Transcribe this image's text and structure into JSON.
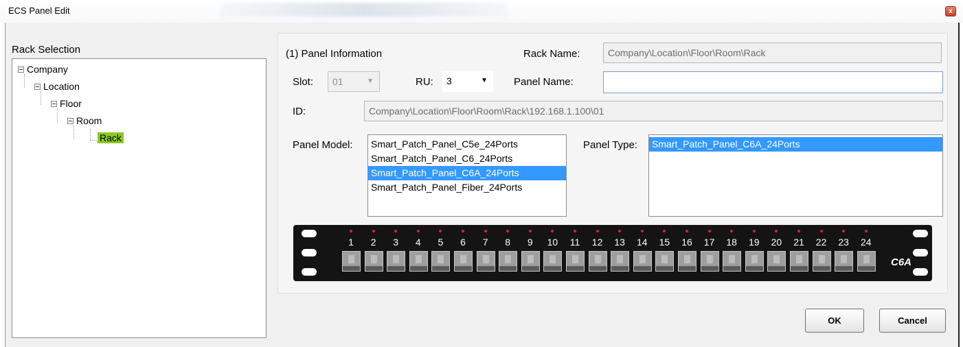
{
  "window": {
    "title": "ECS Panel Edit",
    "close_glyph": "x"
  },
  "rack_selection": {
    "label": "Rack Selection",
    "tree": {
      "company": "Company",
      "location": "Location",
      "floor": "Floor",
      "room": "Room",
      "rack": "Rack"
    },
    "selected_color": "#8ac927"
  },
  "panel_info": {
    "section_title": "(1) Panel Information",
    "rack_name_label": "Rack Name:",
    "rack_name_value": "Company\\Location\\Floor\\Room\\Rack",
    "slot_label": "Slot:",
    "slot_value": "01",
    "ru_label": "RU:",
    "ru_value": "3",
    "panel_name_label": "Panel Name:",
    "panel_name_value": "",
    "id_label": "ID:",
    "id_value": "Company\\Location\\Floor\\Room\\Rack\\192.168.1.100\\01",
    "panel_model_label": "Panel Model:",
    "panel_models": [
      "Smart_Patch_Panel_C5e_24Ports",
      "Smart_Patch_Panel_C6_24Ports",
      "Smart_Patch_Panel_C6A_24Ports",
      "Smart_Patch_Panel_Fiber_24Ports"
    ],
    "selected_model_index": 2,
    "panel_type_label": "Panel Type:",
    "panel_types": [
      "Smart_Patch_Panel_C6A_24Ports"
    ],
    "selected_type_index": 0
  },
  "patch_panel": {
    "ports": [
      "1",
      "2",
      "3",
      "4",
      "5",
      "6",
      "7",
      "8",
      "9",
      "10",
      "11",
      "12",
      "13",
      "14",
      "15",
      "16",
      "17",
      "18",
      "19",
      "20",
      "21",
      "22",
      "23",
      "24"
    ],
    "badge": "C6A",
    "led_color": "#e02020"
  },
  "buttons": {
    "ok": "OK",
    "cancel": "Cancel"
  },
  "colors": {
    "selection": "#3399ff",
    "panel_body": "#141414"
  },
  "icons": {
    "tree_expander": "minus-box-icon",
    "combo_arrow": "chevron-down-icon"
  }
}
